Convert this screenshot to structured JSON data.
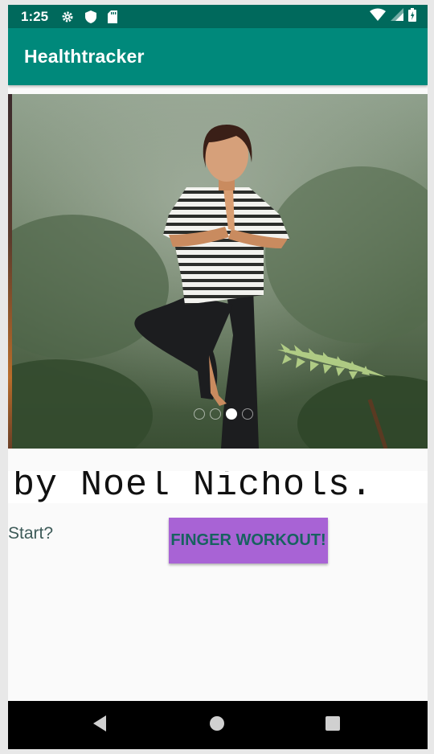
{
  "status_bar": {
    "time": "1:25",
    "icons": [
      "gear-icon",
      "shield-icon",
      "sd-card-icon",
      "wifi-icon",
      "signal-icon",
      "battery-icon"
    ]
  },
  "app_bar": {
    "title": "Healthtracker"
  },
  "carousel": {
    "slide_count": 4,
    "active_index": 2
  },
  "caption": {
    "text": "by Noel Nichols."
  },
  "main": {
    "start_label": "Start?",
    "workout_button": "FINGER WORKOUT!"
  },
  "colors": {
    "status_bar": "#00695c",
    "app_bar": "#00897b",
    "button": "#a863d5",
    "button_text": "#17625f",
    "label_text": "#3d5a58"
  },
  "nav_bar": {
    "icons": [
      "back-icon",
      "home-icon",
      "recents-icon"
    ]
  }
}
